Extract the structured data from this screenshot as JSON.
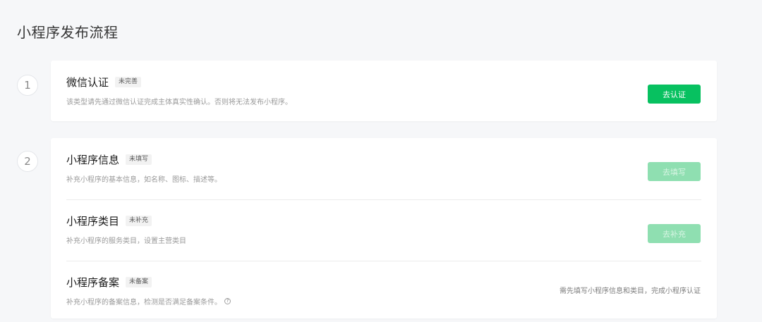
{
  "page": {
    "title": "小程序发布流程"
  },
  "steps": [
    {
      "number": "1",
      "items": [
        {
          "title": "微信认证",
          "badge": "未完善",
          "desc": "该类型请先通过微信认证完成主体真实性确认。否则将无法发布小程序。",
          "action": {
            "type": "button",
            "label": "去认证",
            "enabled": true
          }
        }
      ]
    },
    {
      "number": "2",
      "items": [
        {
          "title": "小程序信息",
          "badge": "未填写",
          "desc": "补充小程序的基本信息，如名称、图标、描述等。",
          "action": {
            "type": "button",
            "label": "去填写",
            "enabled": false
          }
        },
        {
          "title": "小程序类目",
          "badge": "未补充",
          "desc": "补充小程序的服务类目，设置主营类目",
          "action": {
            "type": "button",
            "label": "去补充",
            "enabled": false
          }
        },
        {
          "title": "小程序备案",
          "badge": "未备案",
          "desc": "补充小程序的备案信息，检测是否满足备案条件。",
          "desc_icon": "question-circle-icon",
          "action": {
            "type": "hint",
            "label": "需先填写小程序信息和类目，完成小程序认证"
          }
        }
      ]
    }
  ],
  "colors": {
    "accent": "#07c160",
    "accent_disabled": "#8fdfb1",
    "background": "#f6f7f9"
  }
}
